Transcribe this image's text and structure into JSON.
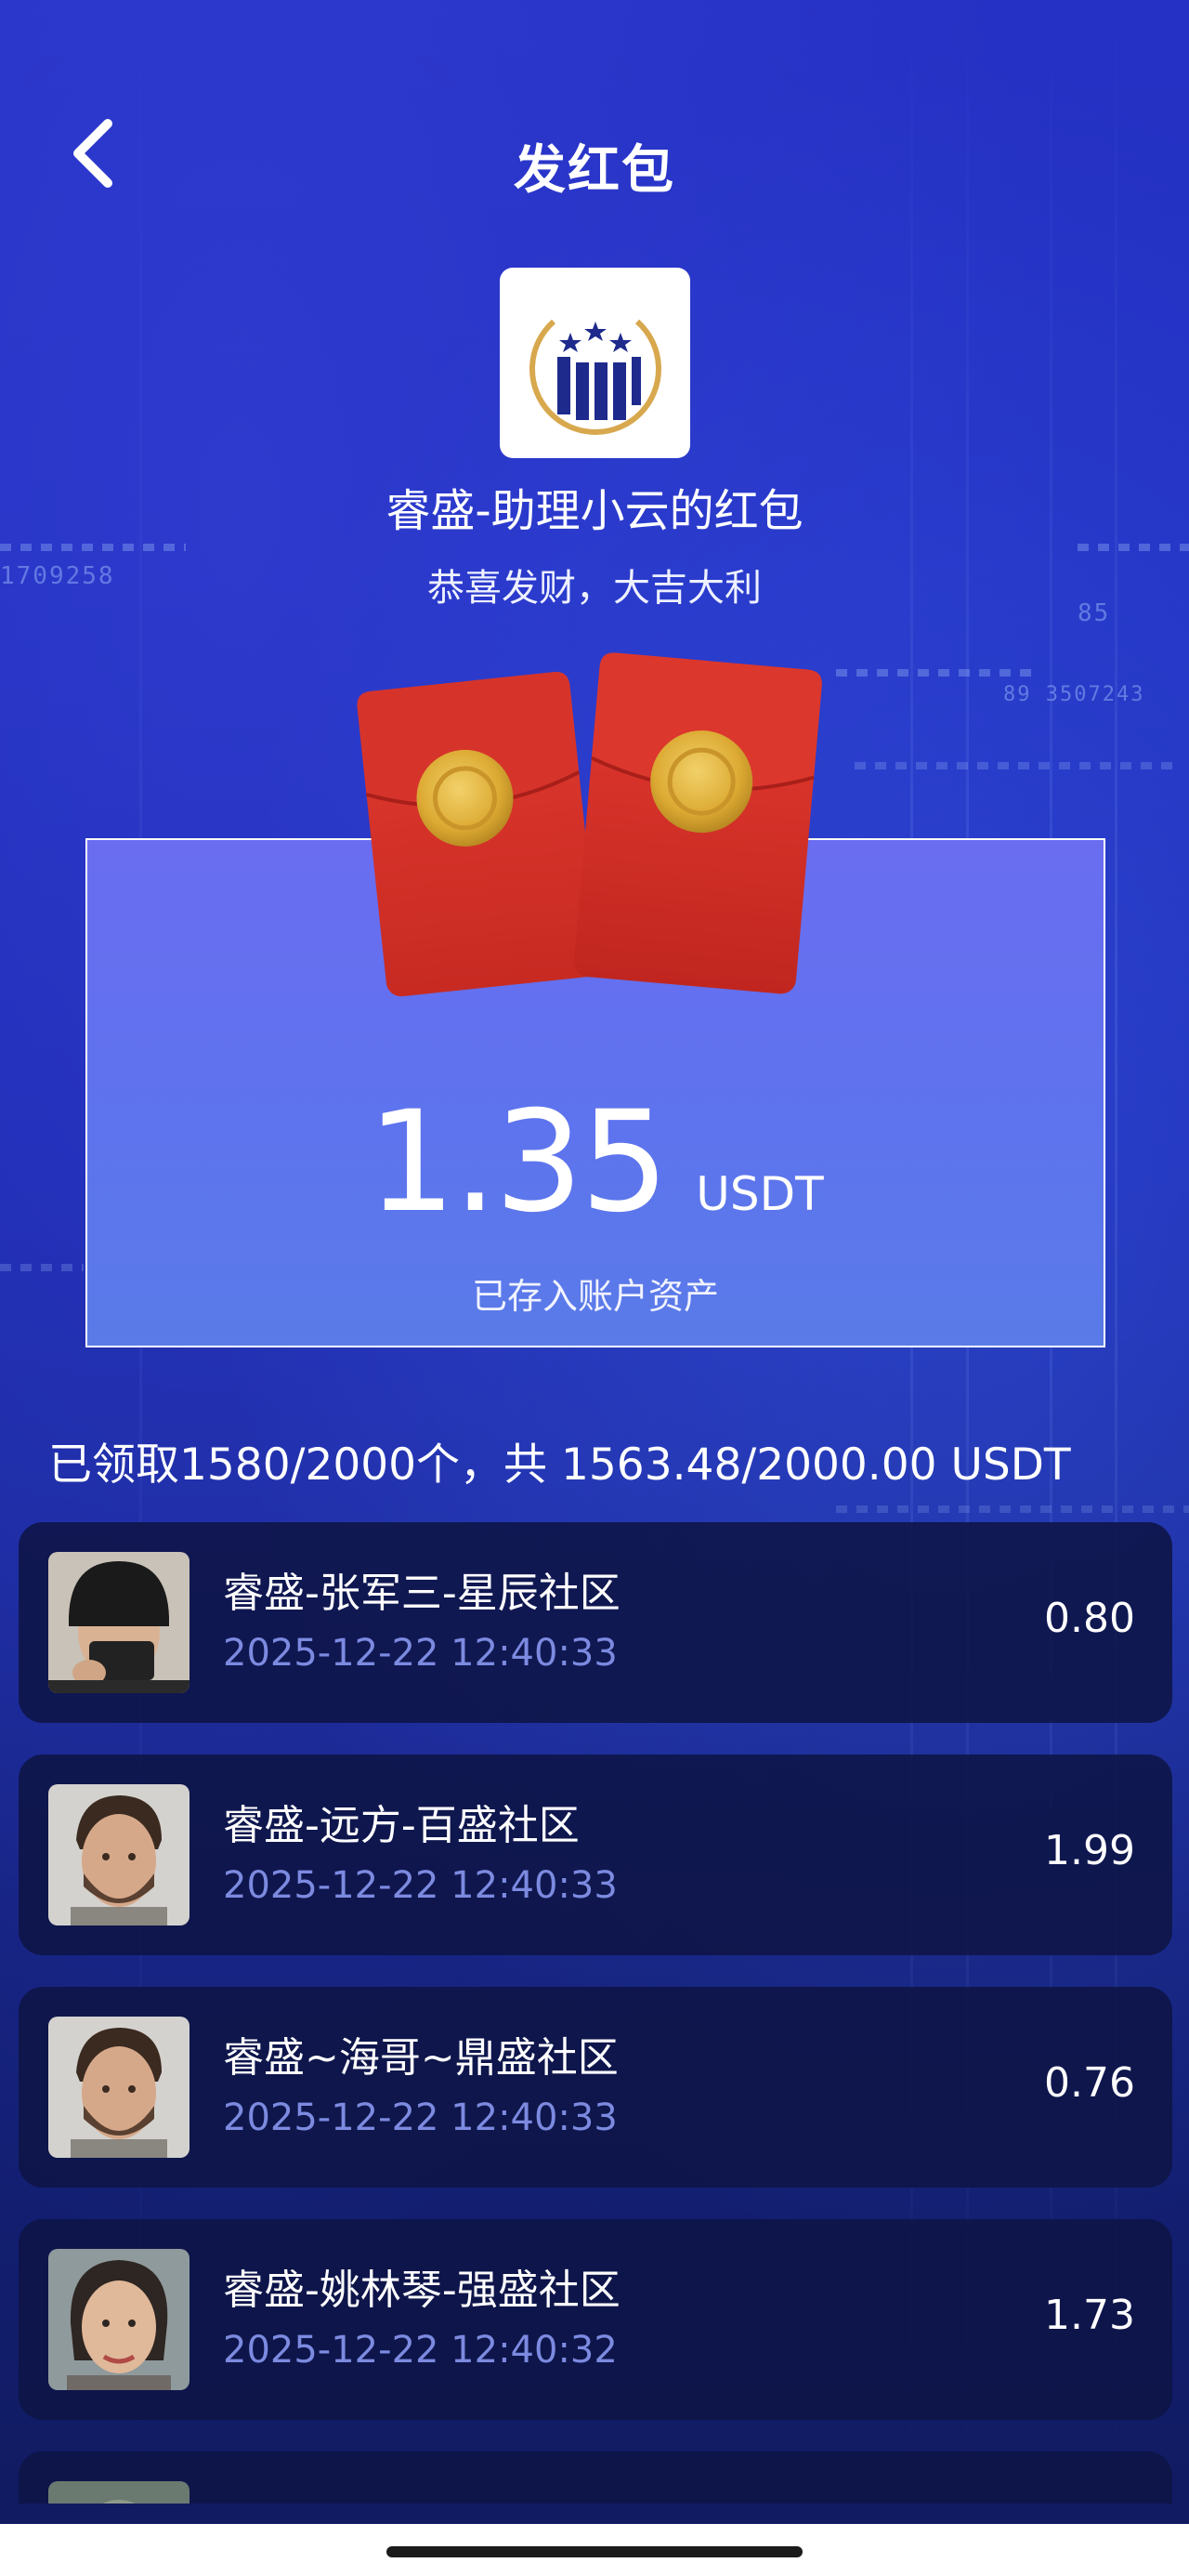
{
  "header": {
    "title": "发红包",
    "back_icon": "chevron-left-icon"
  },
  "red_packet": {
    "logo_icon": "ruisheng-logo-icon",
    "sender": "睿盛-助理小云的红包",
    "greeting": "恭喜发财，大吉大利",
    "amount": "1.35",
    "unit": "USDT",
    "note": "已存入账户资产"
  },
  "summary": "已领取1580/2000个，共 1563.48/2000.00 USDT",
  "records": [
    {
      "name": "睿盛-张军三-星辰社区",
      "time": "2025-12-22 12:40:33",
      "amount": "0.80",
      "avatar": "avatar-beanie-man"
    },
    {
      "name": "睿盛-远方-百盛社区",
      "time": "2025-12-22 12:40:33",
      "amount": "1.99",
      "avatar": "avatar-bearded-man"
    },
    {
      "name": "睿盛~海哥~鼎盛社区",
      "time": "2025-12-22 12:40:33",
      "amount": "0.76",
      "avatar": "avatar-bearded-man"
    },
    {
      "name": "睿盛-姚林琴-强盛社区",
      "time": "2025-12-22 12:40:32",
      "amount": "1.73",
      "avatar": "avatar-woman"
    }
  ],
  "colors": {
    "background": "#1e2db8",
    "card": "#6a6df0",
    "row_bg": "#0e1446",
    "time_text": "#7c8ae0",
    "envelope": "#d9302c",
    "coin": "#e2b63a"
  }
}
